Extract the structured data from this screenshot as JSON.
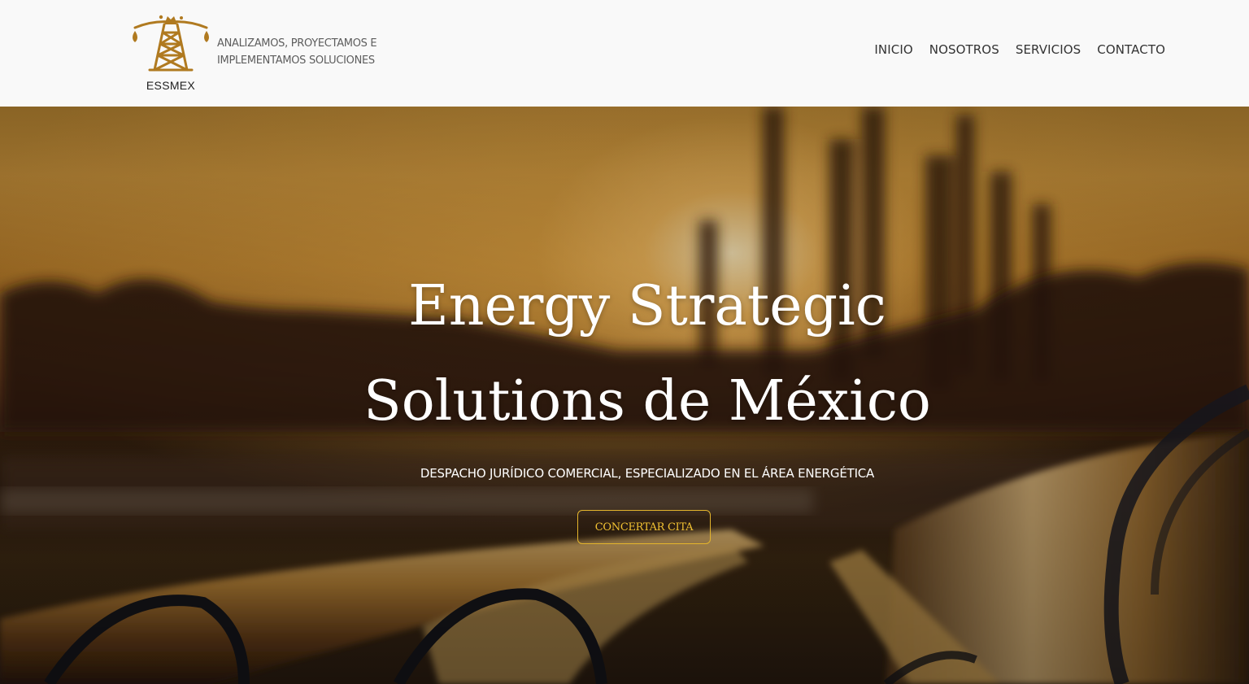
{
  "brand": {
    "logo_text": "ESSMEX",
    "tagline_lines": [
      "ANALIZAMOS, PROYECTAMOS E",
      "IMPLEMENTAMOS SOLUCIONES"
    ],
    "accent_color": "#b07a20"
  },
  "nav": {
    "items": [
      {
        "label": "INICIO"
      },
      {
        "label": "NOSOTROS"
      },
      {
        "label": "SERVICIOS"
      },
      {
        "label": "CONTACTO"
      }
    ]
  },
  "hero": {
    "title_lines": [
      "Energy Strategic",
      "Solutions de México"
    ],
    "subtitle": "DESPACHO JURÍDICO COMERCIAL, ESPECIALIZADO EN EL ÁREA ENERGÉTICA",
    "cta_label": "CONCERTAR CITA",
    "cta_color": "#f2c233"
  }
}
